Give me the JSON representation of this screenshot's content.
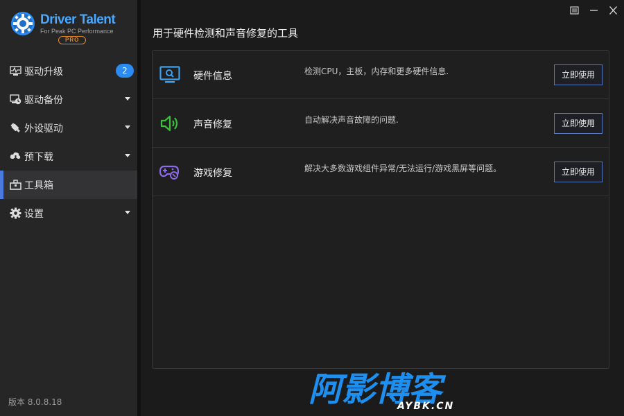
{
  "app": {
    "brand_name": "Driver Talent",
    "tagline": "For Peak PC Performance",
    "edition": "PRO"
  },
  "sidebar": {
    "items": [
      {
        "label": "驱动升级",
        "icon": "monitor-pulse-icon",
        "badge": "2"
      },
      {
        "label": "驱动备份",
        "icon": "backup-clock-icon"
      },
      {
        "label": "外设驱动",
        "icon": "usb-plug-icon"
      },
      {
        "label": "预下载",
        "icon": "cloud-download-icon"
      },
      {
        "label": "工具箱",
        "icon": "toolbox-icon",
        "active": true
      },
      {
        "label": "设置",
        "icon": "gear-icon"
      }
    ],
    "version": "版本 8.0.8.18"
  },
  "main": {
    "title": "用于硬件检测和声音修复的工具",
    "tools": [
      {
        "name": "硬件信息",
        "desc": "检测CPU，主板，内存和更多硬件信息.",
        "button": "立即使用",
        "icon": "monitor-search-icon",
        "color": "#3aa0f0"
      },
      {
        "name": "声音修复",
        "desc": "自动解决声音故障的问题.",
        "button": "立即使用",
        "icon": "speaker-icon",
        "color": "#3cc03c"
      },
      {
        "name": "游戏修复",
        "desc": "解决大多数游戏组件异常/无法运行/游戏黑屏等问题。",
        "button": "立即使用",
        "icon": "gamepad-icon",
        "color": "#8a6be8"
      }
    ]
  },
  "watermark": {
    "text": "阿影博客",
    "sub": "AYBK.CN"
  },
  "colors": {
    "accent": "#2a8bf2",
    "active_bar": "#4a7adf",
    "button_border": "#5a7bbf"
  }
}
